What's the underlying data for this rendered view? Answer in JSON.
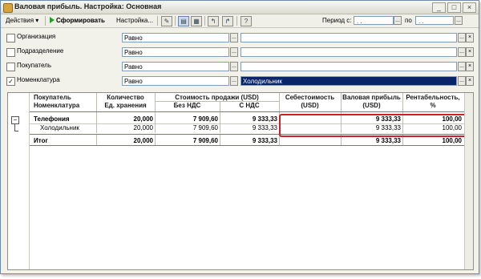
{
  "window": {
    "title": "Валовая прибыль. Настройка: Основная",
    "buttons": [
      "_",
      "□",
      "×"
    ]
  },
  "toolbar": {
    "actions_label": "Действия",
    "generate_label": "Сформировать",
    "settings_label": "Настройка...",
    "period_from_label": "Период с:",
    "period_from_value": ". .",
    "period_to_label": "по",
    "period_to_value": ". .",
    "ellipsis": "..."
  },
  "filters": [
    {
      "label": "Организация",
      "checked": false,
      "condition": "Равно",
      "value": ""
    },
    {
      "label": "Подразделение",
      "checked": false,
      "condition": "Равно",
      "value": ""
    },
    {
      "label": "Покупатель",
      "checked": false,
      "condition": "Равно",
      "value": ""
    },
    {
      "label": "Номенклатура",
      "checked": true,
      "condition": "Равно",
      "value": "Холодильник"
    }
  ],
  "report": {
    "group_toggle": "−",
    "headers": {
      "buyer": "Покупатель",
      "nomenclature": "Номенклатура",
      "quantity": "Количество",
      "unit": "Ед. хранения",
      "sales_cost": "Стоимость продажи (USD)",
      "no_vat": "Без НДС",
      "with_vat": "С НДС",
      "cost_price": "Себестоимость",
      "cost_price_unit": "(USD)",
      "gross_profit": "Валовая прибыль",
      "gross_profit_unit": "(USD)",
      "profitability": "Рентабельность,",
      "profitability_unit": "%"
    },
    "rows": [
      {
        "name": "Телефония",
        "qty": "20,000",
        "no_vat": "7 909,60",
        "with_vat": "9 333,33",
        "cost": "",
        "profit": "9 333,33",
        "rent": "100,00",
        "bold": true
      },
      {
        "name": "Холодильник",
        "qty": "20,000",
        "no_vat": "7 909,60",
        "with_vat": "9 333,33",
        "cost": "",
        "profit": "9 333,33",
        "rent": "100,00",
        "bold": false
      }
    ],
    "total": {
      "name": "Итог",
      "qty": "20,000",
      "no_vat": "7 909,60",
      "with_vat": "9 333,33",
      "cost": "",
      "profit": "9 333,33",
      "rent": "100,00"
    }
  },
  "colors": {
    "highlight": "#cf2027",
    "selection": "#0a246a"
  }
}
